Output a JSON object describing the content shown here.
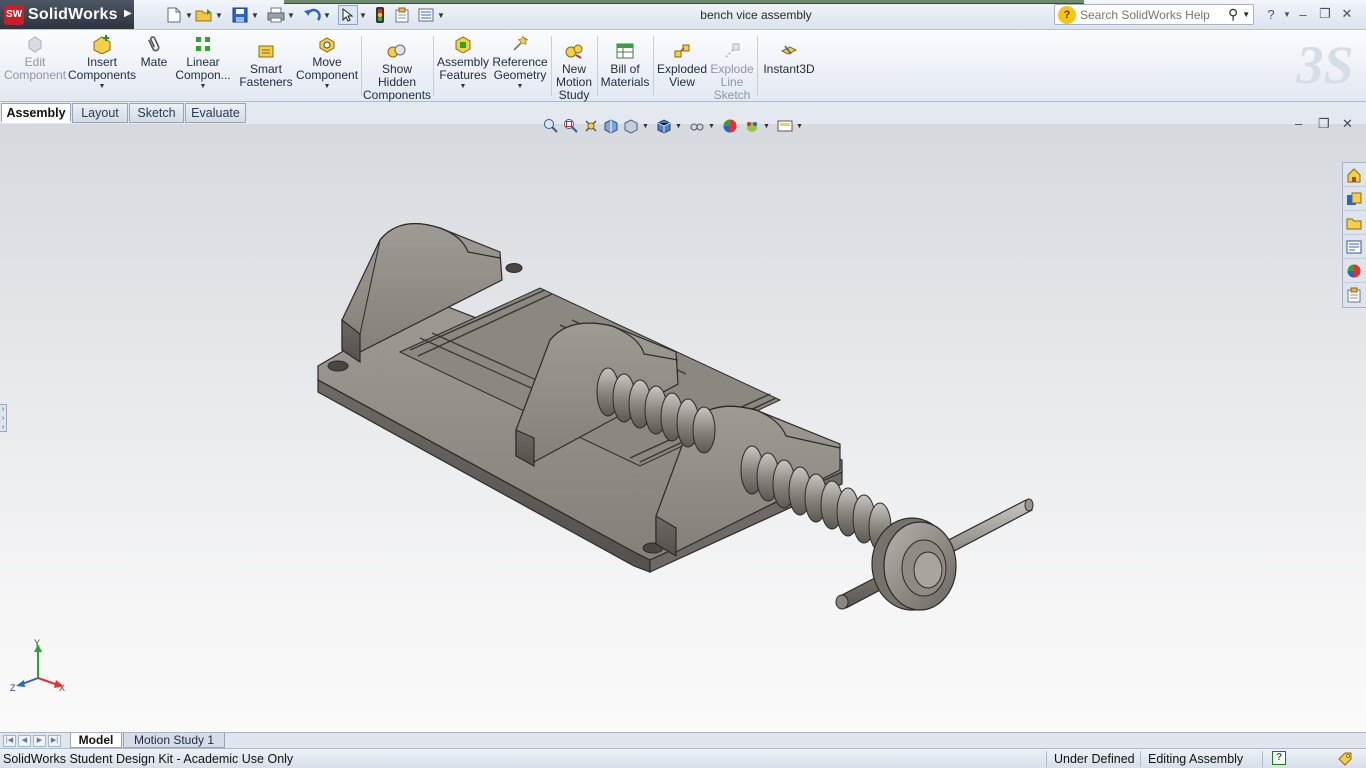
{
  "app": {
    "logo_mark": "SW",
    "logo_text": "SolidWorks",
    "document_title": "bench vice assembly"
  },
  "quick_access": {
    "icons": [
      "new-document-icon",
      "open-folder-icon",
      "save-icon",
      "print-icon",
      "undo-icon",
      "select-arrow-icon",
      "rebuild-traffic-light-icon",
      "file-properties-icon",
      "options-icon"
    ]
  },
  "search": {
    "placeholder": "Search SolidWorks Help"
  },
  "command_manager": {
    "items": [
      {
        "label": "Edit\nComponent",
        "enabled": false
      },
      {
        "label": "Insert\nComponents",
        "enabled": true,
        "dropdown": true
      },
      {
        "label": "Mate",
        "enabled": true
      },
      {
        "label": "Linear\nCompon...",
        "enabled": true,
        "dropdown": true
      },
      {
        "label": "Smart\nFasteners",
        "enabled": true
      },
      {
        "label": "Move\nComponent",
        "enabled": true,
        "dropdown": true
      },
      {
        "label": "Show\nHidden\nComponents",
        "enabled": true
      },
      {
        "label": "Assembly\nFeatures",
        "enabled": true,
        "dropdown": true
      },
      {
        "label": "Reference\nGeometry",
        "enabled": true,
        "dropdown": true
      },
      {
        "label": "New\nMotion\nStudy",
        "enabled": true
      },
      {
        "label": "Bill of\nMaterials",
        "enabled": true
      },
      {
        "label": "Exploded\nView",
        "enabled": true
      },
      {
        "label": "Explode\nLine\nSketch",
        "enabled": false
      },
      {
        "label": "Instant3D",
        "enabled": true
      }
    ]
  },
  "tabs": {
    "assembly": "Assembly",
    "layout": "Layout",
    "sketch": "Sketch",
    "evaluate": "Evaluate",
    "active": "Assembly"
  },
  "triad": {
    "x": "X",
    "y": "Y",
    "z": "Z"
  },
  "bottom_tabs": {
    "model": "Model",
    "motion_study": "Motion Study 1"
  },
  "status_bar": {
    "left": "SolidWorks Student Design Kit - Academic Use Only",
    "state": "Under Defined",
    "mode": "Editing Assembly",
    "help": "?"
  },
  "colors": {
    "accent": "#c8202a",
    "model_body": "#8f8a84",
    "model_dark": "#5f5a55",
    "model_light": "#b5b0aa"
  }
}
